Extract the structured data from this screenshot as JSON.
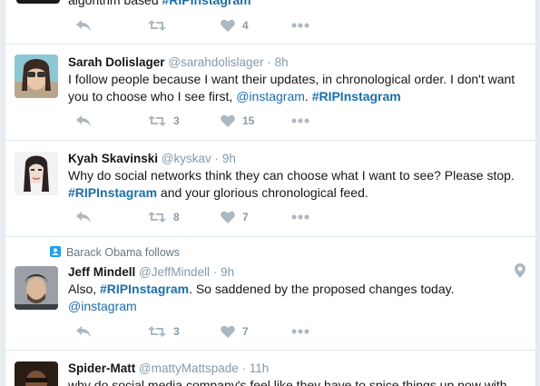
{
  "top_tweet": {
    "text_partial": "algorithm based ",
    "hashtag": "#RIPInstagram",
    "likes": "4"
  },
  "tweets": [
    {
      "name": "Sarah Dolislager",
      "handle": "@sarahdolislager",
      "time": "8h",
      "text_1": "I follow people because I want their updates, in chronological order. I don't want you to choose who I see first, ",
      "mention": "@instagram",
      "text_2": ". ",
      "hashtag": "#RIPInstagram",
      "retweets": "3",
      "likes": "15"
    },
    {
      "name": "Kyah Skavinski",
      "handle": "@kyskav",
      "time": "9h",
      "text_1": "Why do social networks think they can choose what I want to see? Please stop. ",
      "hashtag": "#RIPInstagram",
      "text_2": " and your glorious chronological feed.",
      "retweets": "8",
      "likes": "7"
    },
    {
      "context": "Barack Obama follows",
      "name": "Jeff Mindell",
      "handle": "@JeffMindell",
      "time": "9h",
      "text_1": "Also, ",
      "hashtag": "#RIPInstagram",
      "text_2": ". So saddened by the proposed changes today. ",
      "mention": "@instagram",
      "retweets": "3",
      "likes": "7"
    },
    {
      "name": "Spider-Matt",
      "handle": "@mattyMattspade",
      "time": "11h",
      "text_1": "why do social media company's feel like they have to spice things up now with"
    }
  ],
  "separator": "·",
  "colors": {
    "link": "#1b6faa",
    "muted": "#8899a6",
    "icon": "#aab8c2",
    "border": "#e1e8ed"
  }
}
